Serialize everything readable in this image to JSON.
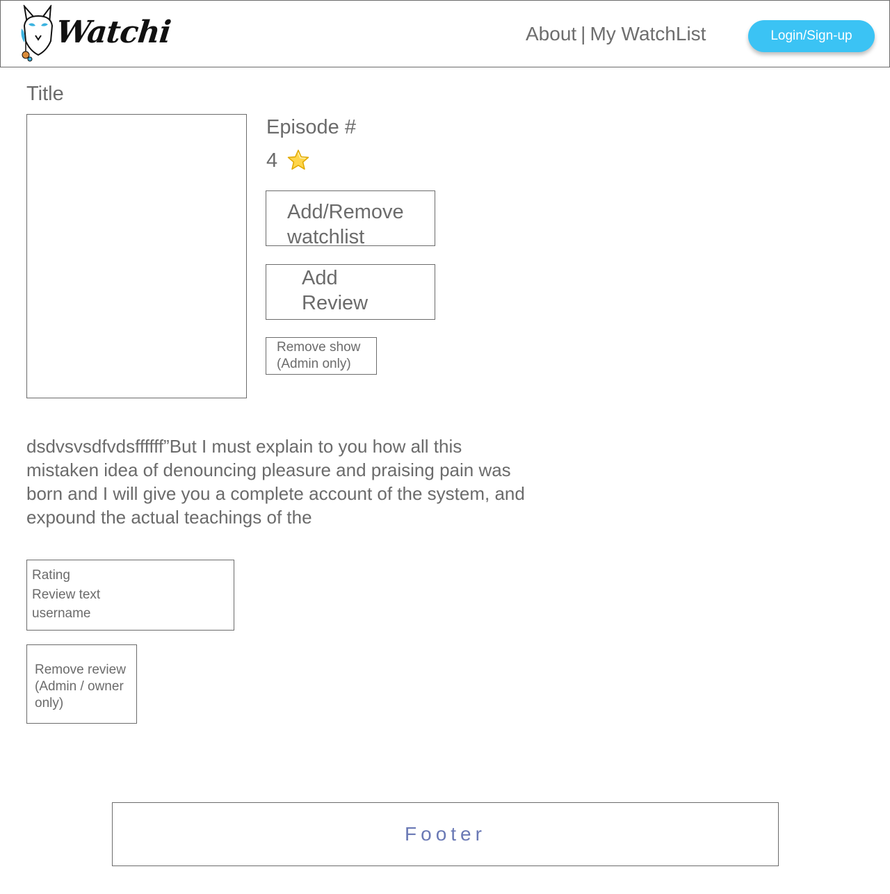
{
  "header": {
    "logo_text": "Watchi",
    "nav": {
      "about": "About",
      "separator": "|",
      "watchlist": "My WatchList"
    },
    "login_label": "Login/Sign-up",
    "login_color": "#3bc3f4"
  },
  "main": {
    "title": "Title",
    "episode": "Episode #",
    "rating_value": "4",
    "rating_icon": "star-icon",
    "buttons": {
      "watchlist_line1": "Add/Remove",
      "watchlist_line2": "watchlist",
      "review_line1": "Add",
      "review_line2": "Review",
      "remove_show_line1": "Remove show",
      "remove_show_line2": "(Admin only)"
    },
    "description": "dsdvsvsdfvdsffffff”But I must explain to you how all this mistaken idea of denouncing pleasure and praising pain was born and I will give you a complete account of the system, and expound the actual teachings of the"
  },
  "review": {
    "rating_label": "Rating",
    "text_label": "Review text",
    "username_label": "username",
    "remove_line1": "Remove review",
    "remove_line2": "(Admin / owner",
    "remove_line3": "only)"
  },
  "footer": {
    "label": "Footer",
    "color": "#6a79b5"
  }
}
